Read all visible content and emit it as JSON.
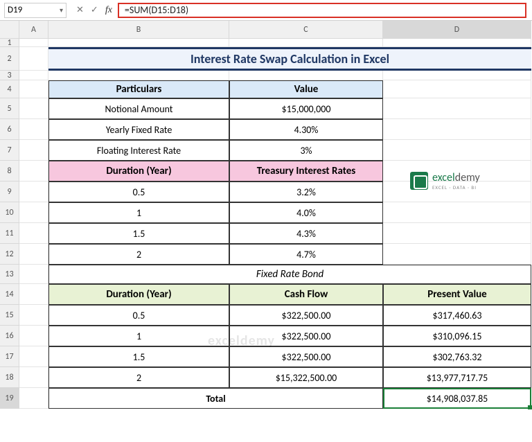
{
  "name_box": "D19",
  "formula": "=SUM(D15:D18)",
  "cols": [
    "A",
    "B",
    "C",
    "D"
  ],
  "rows": [
    "1",
    "2",
    "3",
    "4",
    "5",
    "6",
    "7",
    "8",
    "9",
    "10",
    "11",
    "12",
    "13",
    "14",
    "15",
    "16",
    "17",
    "18",
    "19"
  ],
  "title": "Interest Rate Swap Calculation in Excel",
  "hdr": {
    "particulars": "Particulars",
    "value": "Value",
    "duration": "Duration (Year)",
    "treasury": "Treasury Interest Rates",
    "cashflow": "Cash Flow",
    "pv": "Present Value"
  },
  "params": [
    {
      "label": "Notional Amount",
      "val": "$15,000,000"
    },
    {
      "label": "Yearly Fixed Rate",
      "val": "4.30%"
    },
    {
      "label": "Floating Interest Rate",
      "val": "3%"
    }
  ],
  "treasury": [
    {
      "d": "0.5",
      "r": "3.2%"
    },
    {
      "d": "1",
      "r": "4.0%"
    },
    {
      "d": "1.5",
      "r": "4.3%"
    },
    {
      "d": "2",
      "r": "4.7%"
    }
  ],
  "section": "Fixed Rate Bond",
  "bond": [
    {
      "d": "0.5",
      "cf": "$322,500.00",
      "pv": "$317,460.63"
    },
    {
      "d": "1",
      "cf": "$322,500.00",
      "pv": "$310,096.15"
    },
    {
      "d": "1.5",
      "cf": "$322,500.00",
      "pv": "$302,763.32"
    },
    {
      "d": "2",
      "cf": "$15,322,500.00",
      "pv": "$13,977,717.75"
    }
  ],
  "total_label": "Total",
  "total_val": "$14,908,037.85",
  "logo": {
    "main1": "excel",
    "main2": "demy",
    "sub": "EXCEL · DATA · BI"
  },
  "watermark": "exceldemy"
}
